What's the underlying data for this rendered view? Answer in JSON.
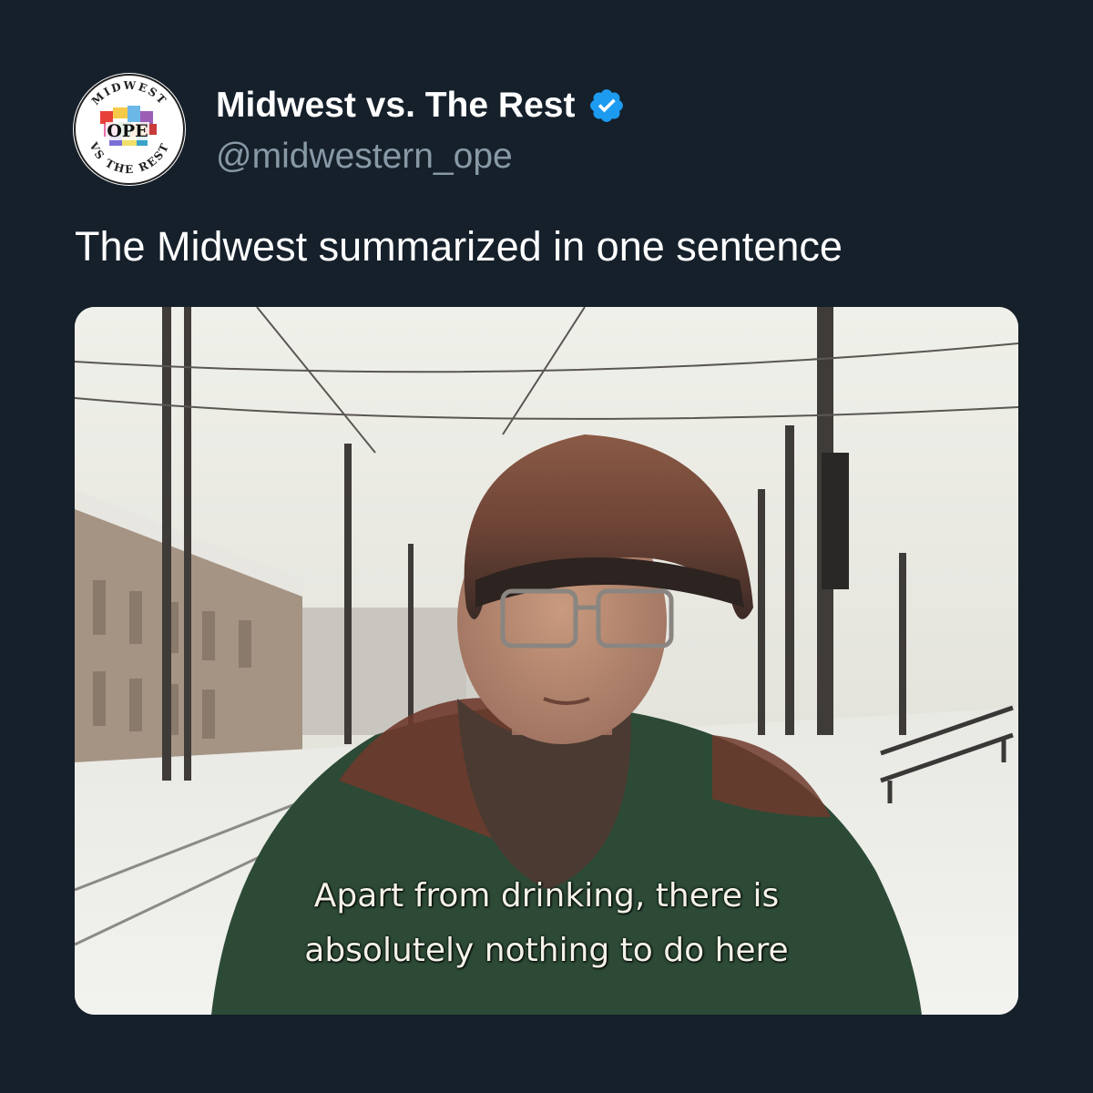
{
  "tweet": {
    "author_name": "Midwest vs. The Rest",
    "handle": "@midwestern_ope",
    "verified": true,
    "verified_icon": "verified-badge-icon",
    "verified_color": "#1d9bf0",
    "text": "The Midwest summarized in one sentence"
  },
  "avatar": {
    "logo_top_text": "MIDWEST",
    "logo_center_text": "OPE",
    "logo_bottom_text": "VS THE REST"
  },
  "media": {
    "subtitle_line_1": "Apart from drinking, there is",
    "subtitle_line_2": "absolutely nothing to do here"
  },
  "colors": {
    "background": "#15202b",
    "primary_text": "#ffffff",
    "secondary_text": "#8899a6"
  }
}
